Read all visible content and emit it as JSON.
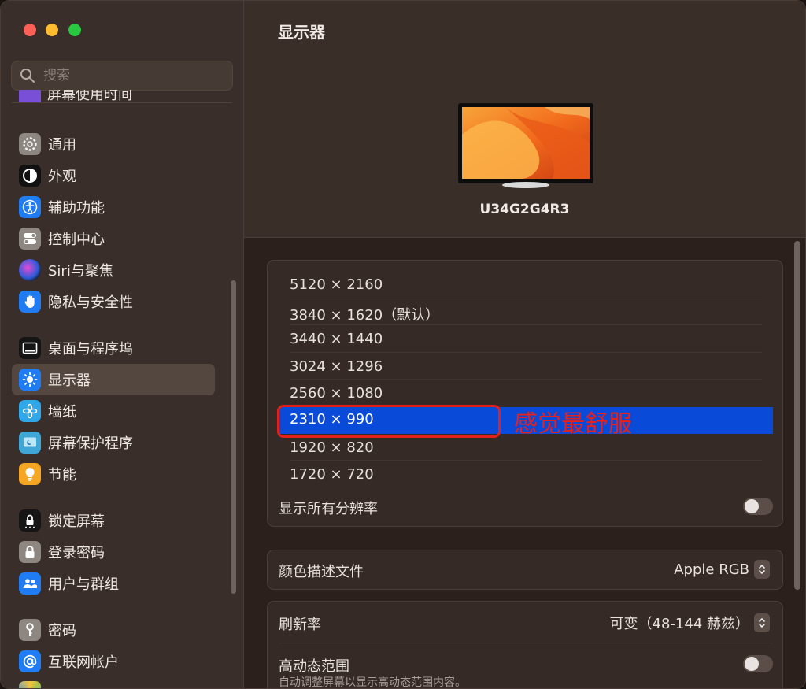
{
  "window": {
    "traffic_lights": [
      "close",
      "minimize",
      "zoom"
    ]
  },
  "sidebar": {
    "search_placeholder": "搜索",
    "partial_item_label": "屏幕使用时间",
    "items": [
      {
        "label": "通用",
        "icon": "gear-icon"
      },
      {
        "label": "外观",
        "icon": "appearance-icon"
      },
      {
        "label": "辅助功能",
        "icon": "accessibility-icon"
      },
      {
        "label": "控制中心",
        "icon": "control-center-icon"
      },
      {
        "label": "Siri与聚焦",
        "icon": "siri-icon"
      },
      {
        "label": "隐私与安全性",
        "icon": "hand-icon"
      },
      {
        "label": "桌面与程序坞",
        "icon": "dock-icon"
      },
      {
        "label": "显示器",
        "icon": "sun-icon",
        "selected": true
      },
      {
        "label": "墙纸",
        "icon": "flower-icon"
      },
      {
        "label": "屏幕保护程序",
        "icon": "screensaver-icon"
      },
      {
        "label": "节能",
        "icon": "lightbulb-icon"
      },
      {
        "label": "锁定屏幕",
        "icon": "lock-screen-icon"
      },
      {
        "label": "登录密码",
        "icon": "padlock-icon"
      },
      {
        "label": "用户与群组",
        "icon": "users-icon"
      },
      {
        "label": "密码",
        "icon": "key-icon"
      },
      {
        "label": "互联网帐户",
        "icon": "at-icon"
      }
    ]
  },
  "main": {
    "title": "显示器",
    "monitor_name": "U34G2G4R3",
    "resolutions": [
      "5120 × 2160",
      "3840 × 1620（默认）",
      "3440 × 1440",
      "3024 × 1296",
      "2560 × 1080",
      "2310 × 990",
      "1920 × 820",
      "1720 × 720"
    ],
    "selected_resolution": "2310 × 990",
    "annotation": "感觉最舒服",
    "show_all_resolutions": {
      "label": "显示所有分辨率",
      "on": false
    },
    "color_profile": {
      "label": "颜色描述文件",
      "value": "Apple RGB"
    },
    "refresh_rate": {
      "label": "刷新率",
      "value": "可变（48-144 赫兹）"
    },
    "hdr": {
      "label": "高动态范围",
      "description": "自动调整屏幕以显示高动态范围内容。",
      "on": false
    }
  },
  "colors": {
    "selection_blue": "#0a4ad8",
    "annotation_red": "#e4211c",
    "sidebar_bg": "#3a2e2a",
    "main_bg": "#2b201c"
  }
}
